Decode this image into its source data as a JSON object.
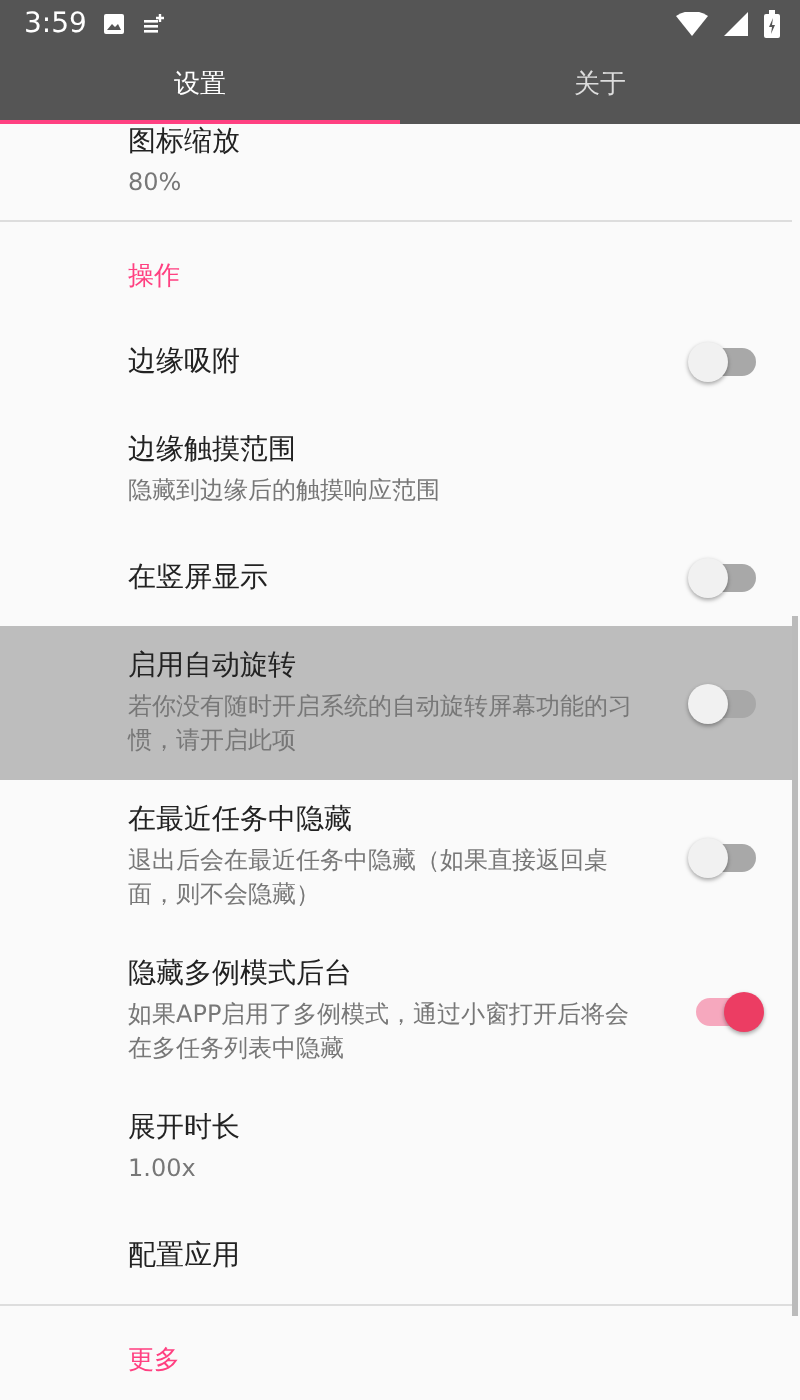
{
  "status_bar": {
    "time": "3:59"
  },
  "tabs": [
    {
      "label": "设置",
      "selected": true
    },
    {
      "label": "关于",
      "selected": false
    }
  ],
  "sections": [
    {
      "items": [
        {
          "kind": "plain",
          "title": "图标缩放",
          "summary": "80%",
          "pressed": false
        }
      ]
    },
    {
      "header": "操作",
      "items": [
        {
          "kind": "switch",
          "title": "边缘吸附",
          "on": false,
          "pressed": false
        },
        {
          "kind": "plain",
          "title": "边缘触摸范围",
          "summary": "隐藏到边缘后的触摸响应范围",
          "pressed": false
        },
        {
          "kind": "switch",
          "title": "在竖屏显示",
          "on": false,
          "pressed": false
        },
        {
          "kind": "switch",
          "title": "启用自动旋转",
          "summary": "若你没有随时开启系统的自动旋转屏幕功能的习惯，请开启此项",
          "on": false,
          "pressed": true
        },
        {
          "kind": "switch",
          "title": "在最近任务中隐藏",
          "summary": "退出后会在最近任务中隐藏（如果直接返回桌面，则不会隐藏）",
          "on": false,
          "pressed": false
        },
        {
          "kind": "switch",
          "title": "隐藏多例模式后台",
          "summary": "如果APP启用了多例模式，通过小窗打开后将会在多任务列表中隐藏",
          "on": true,
          "pressed": false
        },
        {
          "kind": "plain",
          "title": "展开时长",
          "summary": "1.00x",
          "pressed": false
        },
        {
          "kind": "plain",
          "title": "配置应用",
          "pressed": false
        }
      ]
    },
    {
      "header": "更多"
    }
  ]
}
